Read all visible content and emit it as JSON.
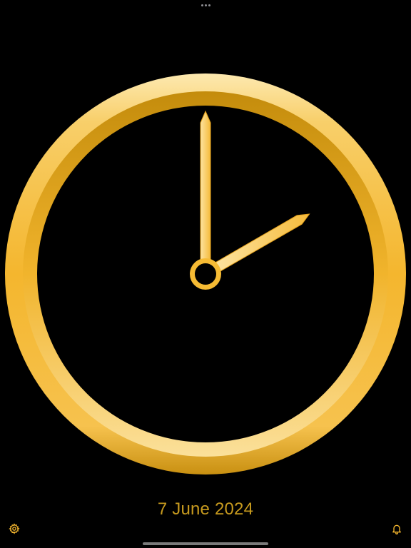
{
  "clock": {
    "hour": 2,
    "minute": 0,
    "hour_hand_icon": "hour-hand",
    "minute_hand_icon": "minute-hand"
  },
  "date": {
    "text": "7 June 2024"
  },
  "toolbar": {
    "settings_icon": "gear-icon",
    "alarm_icon": "bell-icon"
  },
  "colors": {
    "background": "#000000",
    "gold": "#f4b62e",
    "gold_light": "#fde6a6",
    "gold_dark": "#c8900a",
    "date_text": "#c79a1e"
  }
}
